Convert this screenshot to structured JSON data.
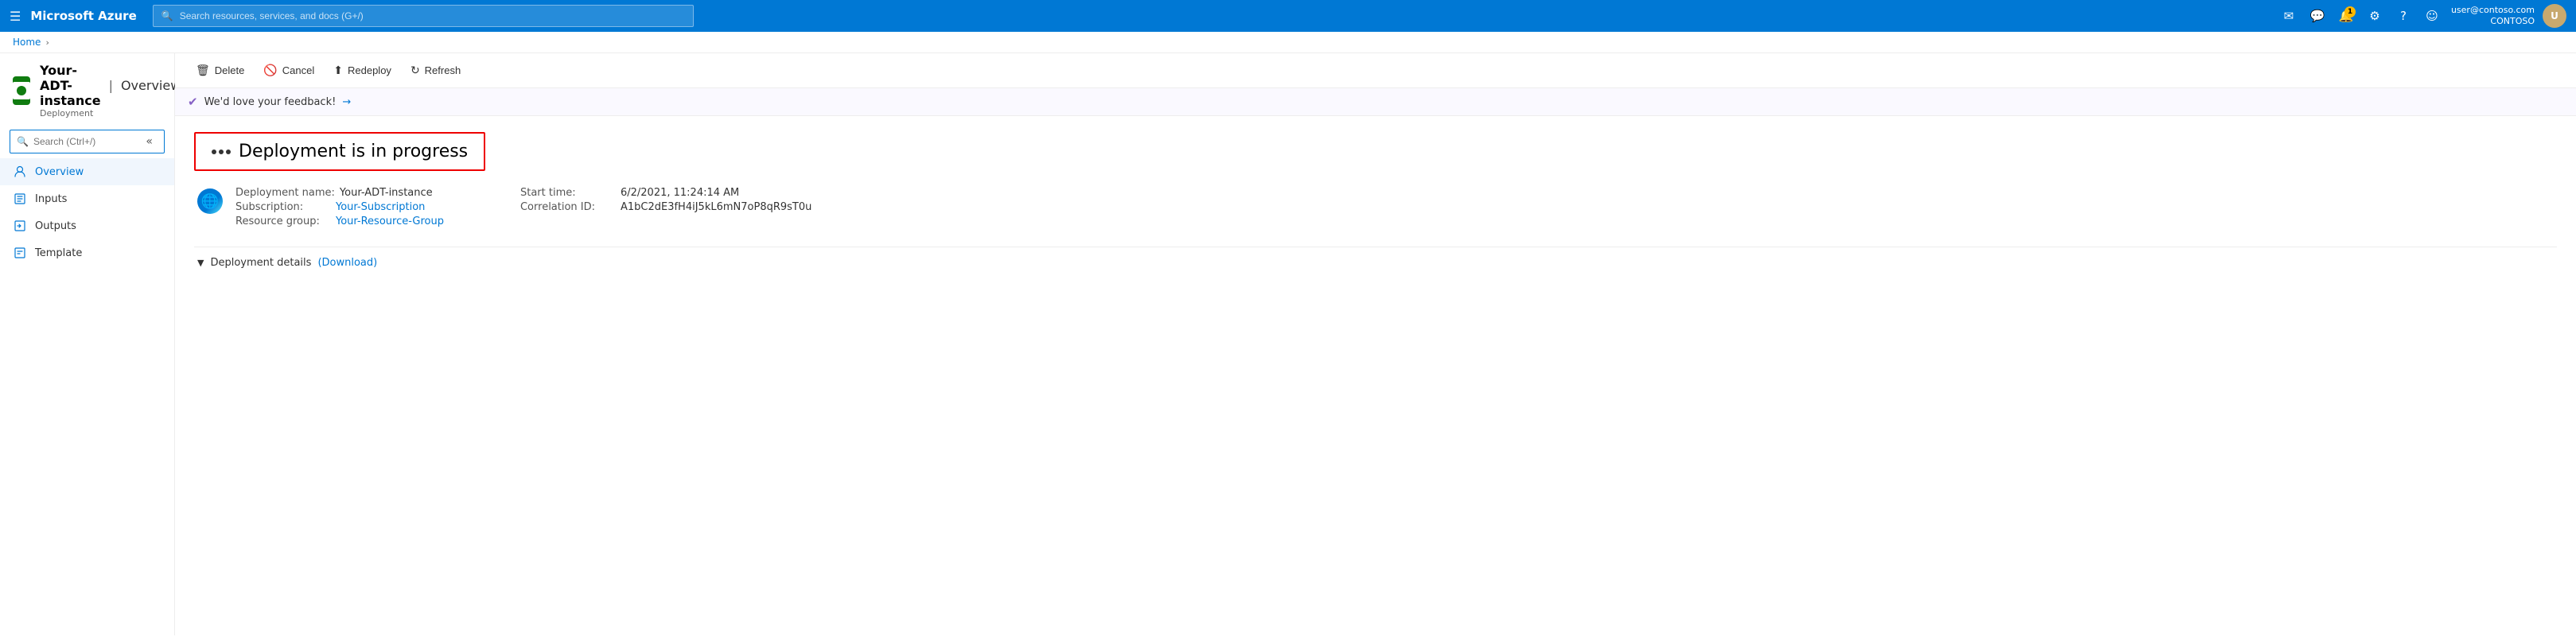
{
  "topbar": {
    "brand": "Microsoft Azure",
    "search_placeholder": "Search resources, services, and docs (G+/)",
    "user_email": "user@contoso.com",
    "user_tenant": "CONTOSO",
    "user_initials": "U",
    "notification_count": "1"
  },
  "breadcrumb": {
    "home": "Home",
    "separator": "›"
  },
  "sidebar": {
    "resource_title": "Your-ADT-instance",
    "resource_type": "Deployment",
    "separator": "|",
    "section_label": "Overview",
    "search_placeholder": "Search (Ctrl+/)",
    "collapse_label": "«",
    "nav_items": [
      {
        "id": "overview",
        "label": "Overview",
        "icon": "person"
      },
      {
        "id": "inputs",
        "label": "Inputs",
        "icon": "inputs"
      },
      {
        "id": "outputs",
        "label": "Outputs",
        "icon": "outputs"
      },
      {
        "id": "template",
        "label": "Template",
        "icon": "template"
      }
    ]
  },
  "toolbar": {
    "delete_label": "Delete",
    "cancel_label": "Cancel",
    "redeploy_label": "Redeploy",
    "refresh_label": "Refresh"
  },
  "feedback": {
    "message": "We'd love your feedback!",
    "arrow": "→"
  },
  "status": {
    "heading": "Deployment is in progress"
  },
  "deployment": {
    "name_label": "Deployment name:",
    "name_value": "Your-ADT-instance",
    "subscription_label": "Subscription:",
    "subscription_value": "Your-Subscription",
    "resource_group_label": "Resource group:",
    "resource_group_value": "Your-Resource-Group",
    "start_time_label": "Start time:",
    "start_time_value": "6/2/2021, 11:24:14 AM",
    "correlation_label": "Correlation ID:",
    "correlation_value": "A1bC2dE3fH4iJ5kL6mN7oP8qR9sT0u"
  },
  "details": {
    "label": "Deployment details",
    "download_label": "(Download)"
  }
}
